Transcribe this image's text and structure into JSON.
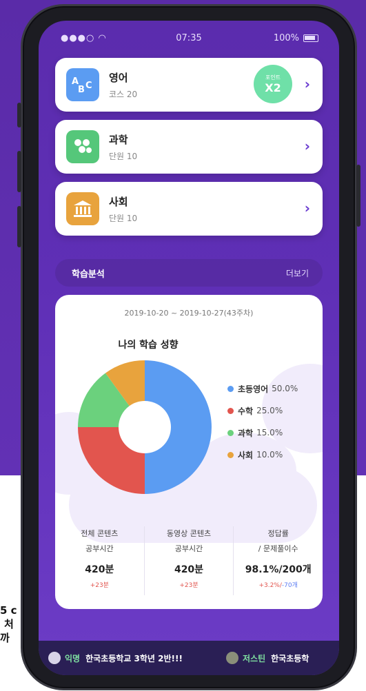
{
  "status_bar": {
    "signal": "●●●○",
    "time": "07:35",
    "battery": "100%"
  },
  "subjects": [
    {
      "title": "영어",
      "subtitle": "코스 20",
      "icon": "abc-icon",
      "icon_text": "ABC",
      "color": "#5b9cf2"
    },
    {
      "title": "과학",
      "subtitle": "단원 10",
      "icon": "molecule-icon",
      "color": "#55c77a"
    },
    {
      "title": "사회",
      "subtitle": "단원 10",
      "icon": "museum-icon",
      "color": "#e8a33d"
    }
  ],
  "badge": {
    "label": "포인트",
    "value": "X2"
  },
  "section": {
    "title": "학습분석",
    "more": "더보기"
  },
  "analysis": {
    "period": "2019-10-20 ~ 2019-10-27(43주차)",
    "chart_title": "나의 학습 성향"
  },
  "chart_data": {
    "type": "pie",
    "title": "나의 학습 성향",
    "donut": true,
    "categories": [
      "초등영어",
      "수학",
      "과학",
      "사회"
    ],
    "values": [
      50.0,
      25.0,
      15.0,
      10.0
    ],
    "labels": [
      "50.0%",
      "25.0%",
      "15.0%",
      "10.0%"
    ],
    "colors": [
      "#5b9cf2",
      "#e2554e",
      "#6bd17d",
      "#e8a33d"
    ],
    "legend": "right"
  },
  "stats": [
    {
      "line1": "전체 콘텐츠",
      "line2": "공부시간",
      "value": "420분",
      "diff": "+23분",
      "diff_extra": ""
    },
    {
      "line1": "동영상 콘텐츠",
      "line2": "공부시간",
      "value": "420분",
      "diff": "+23분",
      "diff_extra": ""
    },
    {
      "line1": "정답률",
      "line2": "/ 문제풀이수",
      "value": "98.1%/200개",
      "diff": "+3.2%/",
      "diff_extra": "-70개"
    }
  ],
  "ticker": [
    {
      "name": "익명",
      "message": "한국초등학교 3학년 2반!!!"
    },
    {
      "name": "저스틴",
      "message": "한국초등학"
    }
  ],
  "side_text": [
    "5 c",
    "처",
    "까"
  ],
  "colors": {
    "diff_positive": "#e2554e",
    "diff_negative": "#5b7cf2"
  }
}
